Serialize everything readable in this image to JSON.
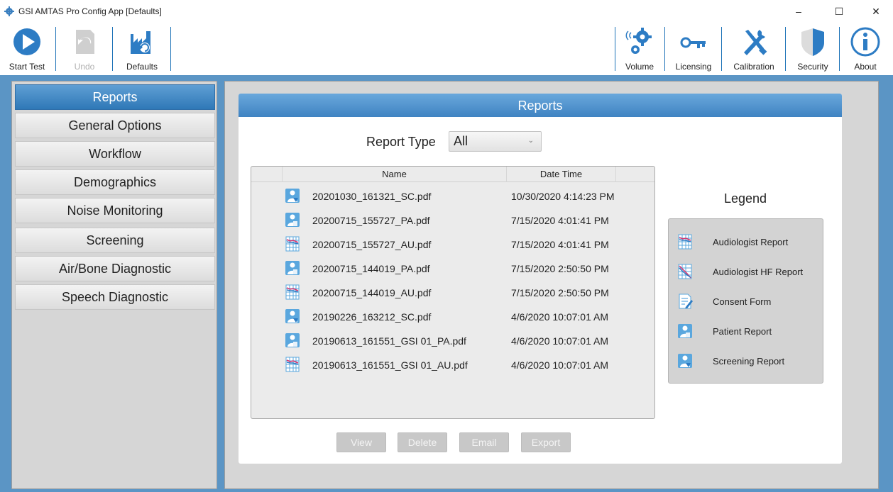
{
  "window": {
    "title": "GSI AMTAS Pro Config App [Defaults]",
    "minimize": "–",
    "maximize": "☐",
    "close": "✕"
  },
  "toolbar": {
    "start_test": "Start Test",
    "undo": "Undo",
    "defaults": "Defaults",
    "volume": "Volume",
    "licensing": "Licensing",
    "calibration": "Calibration",
    "security": "Security",
    "about": "About"
  },
  "sidebar": {
    "items": [
      {
        "label": "Reports",
        "active": true
      },
      {
        "label": "General Options",
        "active": false
      },
      {
        "label": "Workflow",
        "active": false
      },
      {
        "label": "Demographics",
        "active": false
      },
      {
        "label": "Noise Monitoring",
        "active": false
      },
      {
        "label": "Screening",
        "active": false
      },
      {
        "label": "Air/Bone Diagnostic",
        "active": false
      },
      {
        "label": "Speech Diagnostic",
        "active": false
      }
    ]
  },
  "reports": {
    "header": "Reports",
    "report_type_label": "Report Type",
    "report_type_value": "All",
    "columns": {
      "name": "Name",
      "date_time": "Date Time"
    },
    "files": [
      {
        "name": "20201030_161321_SC.pdf",
        "date": "10/30/2020 4:14:23 PM",
        "icon": "screening-report-icon"
      },
      {
        "name": "20200715_155727_PA.pdf",
        "date": "7/15/2020 4:01:41 PM",
        "icon": "patient-report-icon"
      },
      {
        "name": "20200715_155727_AU.pdf",
        "date": "7/15/2020 4:01:41 PM",
        "icon": "audiologist-report-icon"
      },
      {
        "name": "20200715_144019_PA.pdf",
        "date": "7/15/2020 2:50:50 PM",
        "icon": "patient-report-icon"
      },
      {
        "name": "20200715_144019_AU.pdf",
        "date": "7/15/2020 2:50:50 PM",
        "icon": "audiologist-report-icon"
      },
      {
        "name": "20190226_163212_SC.pdf",
        "date": "4/6/2020 10:07:01 AM",
        "icon": "screening-report-icon"
      },
      {
        "name": "20190613_161551_GSI 01_PA.pdf",
        "date": "4/6/2020 10:07:01 AM",
        "icon": "patient-report-icon"
      },
      {
        "name": "20190613_161551_GSI 01_AU.pdf",
        "date": "4/6/2020 10:07:01 AM",
        "icon": "audiologist-report-icon"
      }
    ],
    "buttons": {
      "view": "View",
      "delete": "Delete",
      "email": "Email",
      "export": "Export"
    }
  },
  "legend": {
    "title": "Legend",
    "items": [
      {
        "label": "Audiologist Report",
        "icon": "audiologist-report-icon"
      },
      {
        "label": "Audiologist HF Report",
        "icon": "audiologist-hf-report-icon"
      },
      {
        "label": "Consent Form",
        "icon": "consent-form-icon"
      },
      {
        "label": "Patient Report",
        "icon": "patient-report-icon"
      },
      {
        "label": "Screening Report",
        "icon": "screening-report-icon"
      }
    ]
  },
  "colors": {
    "accent": "#2f78b7",
    "frame": "#5b95c5",
    "panel": "#d6d6d6"
  }
}
